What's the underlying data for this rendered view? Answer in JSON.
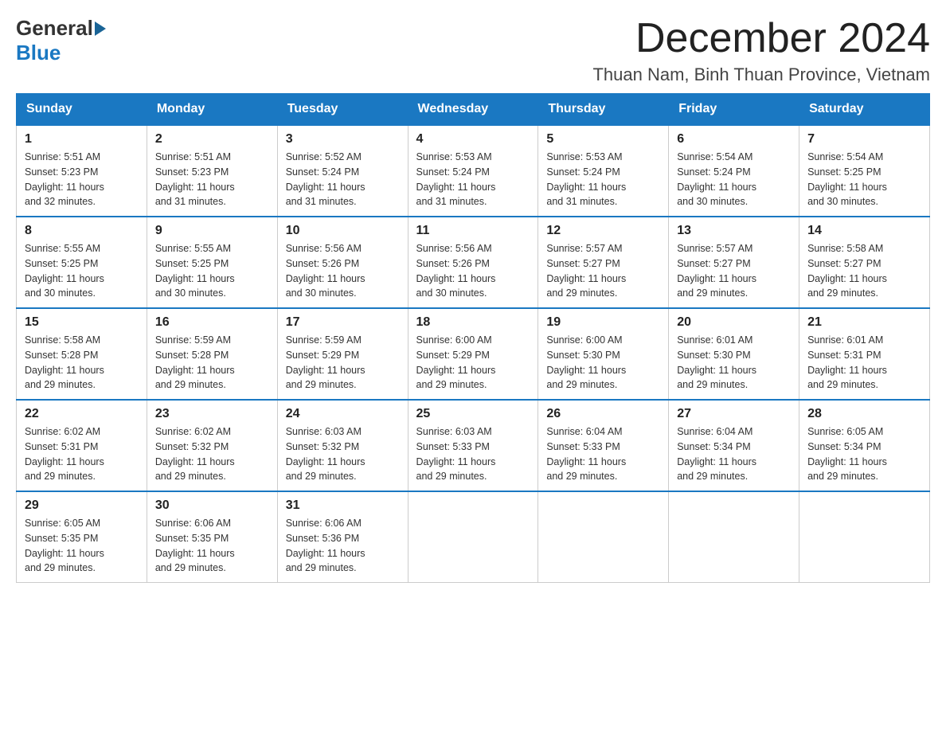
{
  "logo": {
    "general": "General",
    "blue": "Blue"
  },
  "title": "December 2024",
  "location": "Thuan Nam, Binh Thuan Province, Vietnam",
  "weekdays": [
    "Sunday",
    "Monday",
    "Tuesday",
    "Wednesday",
    "Thursday",
    "Friday",
    "Saturday"
  ],
  "weeks": [
    [
      {
        "day": "1",
        "sunrise": "5:51 AM",
        "sunset": "5:23 PM",
        "daylight": "11 hours and 32 minutes."
      },
      {
        "day": "2",
        "sunrise": "5:51 AM",
        "sunset": "5:23 PM",
        "daylight": "11 hours and 31 minutes."
      },
      {
        "day": "3",
        "sunrise": "5:52 AM",
        "sunset": "5:24 PM",
        "daylight": "11 hours and 31 minutes."
      },
      {
        "day": "4",
        "sunrise": "5:53 AM",
        "sunset": "5:24 PM",
        "daylight": "11 hours and 31 minutes."
      },
      {
        "day": "5",
        "sunrise": "5:53 AM",
        "sunset": "5:24 PM",
        "daylight": "11 hours and 31 minutes."
      },
      {
        "day": "6",
        "sunrise": "5:54 AM",
        "sunset": "5:24 PM",
        "daylight": "11 hours and 30 minutes."
      },
      {
        "day": "7",
        "sunrise": "5:54 AM",
        "sunset": "5:25 PM",
        "daylight": "11 hours and 30 minutes."
      }
    ],
    [
      {
        "day": "8",
        "sunrise": "5:55 AM",
        "sunset": "5:25 PM",
        "daylight": "11 hours and 30 minutes."
      },
      {
        "day": "9",
        "sunrise": "5:55 AM",
        "sunset": "5:25 PM",
        "daylight": "11 hours and 30 minutes."
      },
      {
        "day": "10",
        "sunrise": "5:56 AM",
        "sunset": "5:26 PM",
        "daylight": "11 hours and 30 minutes."
      },
      {
        "day": "11",
        "sunrise": "5:56 AM",
        "sunset": "5:26 PM",
        "daylight": "11 hours and 30 minutes."
      },
      {
        "day": "12",
        "sunrise": "5:57 AM",
        "sunset": "5:27 PM",
        "daylight": "11 hours and 29 minutes."
      },
      {
        "day": "13",
        "sunrise": "5:57 AM",
        "sunset": "5:27 PM",
        "daylight": "11 hours and 29 minutes."
      },
      {
        "day": "14",
        "sunrise": "5:58 AM",
        "sunset": "5:27 PM",
        "daylight": "11 hours and 29 minutes."
      }
    ],
    [
      {
        "day": "15",
        "sunrise": "5:58 AM",
        "sunset": "5:28 PM",
        "daylight": "11 hours and 29 minutes."
      },
      {
        "day": "16",
        "sunrise": "5:59 AM",
        "sunset": "5:28 PM",
        "daylight": "11 hours and 29 minutes."
      },
      {
        "day": "17",
        "sunrise": "5:59 AM",
        "sunset": "5:29 PM",
        "daylight": "11 hours and 29 minutes."
      },
      {
        "day": "18",
        "sunrise": "6:00 AM",
        "sunset": "5:29 PM",
        "daylight": "11 hours and 29 minutes."
      },
      {
        "day": "19",
        "sunrise": "6:00 AM",
        "sunset": "5:30 PM",
        "daylight": "11 hours and 29 minutes."
      },
      {
        "day": "20",
        "sunrise": "6:01 AM",
        "sunset": "5:30 PM",
        "daylight": "11 hours and 29 minutes."
      },
      {
        "day": "21",
        "sunrise": "6:01 AM",
        "sunset": "5:31 PM",
        "daylight": "11 hours and 29 minutes."
      }
    ],
    [
      {
        "day": "22",
        "sunrise": "6:02 AM",
        "sunset": "5:31 PM",
        "daylight": "11 hours and 29 minutes."
      },
      {
        "day": "23",
        "sunrise": "6:02 AM",
        "sunset": "5:32 PM",
        "daylight": "11 hours and 29 minutes."
      },
      {
        "day": "24",
        "sunrise": "6:03 AM",
        "sunset": "5:32 PM",
        "daylight": "11 hours and 29 minutes."
      },
      {
        "day": "25",
        "sunrise": "6:03 AM",
        "sunset": "5:33 PM",
        "daylight": "11 hours and 29 minutes."
      },
      {
        "day": "26",
        "sunrise": "6:04 AM",
        "sunset": "5:33 PM",
        "daylight": "11 hours and 29 minutes."
      },
      {
        "day": "27",
        "sunrise": "6:04 AM",
        "sunset": "5:34 PM",
        "daylight": "11 hours and 29 minutes."
      },
      {
        "day": "28",
        "sunrise": "6:05 AM",
        "sunset": "5:34 PM",
        "daylight": "11 hours and 29 minutes."
      }
    ],
    [
      {
        "day": "29",
        "sunrise": "6:05 AM",
        "sunset": "5:35 PM",
        "daylight": "11 hours and 29 minutes."
      },
      {
        "day": "30",
        "sunrise": "6:06 AM",
        "sunset": "5:35 PM",
        "daylight": "11 hours and 29 minutes."
      },
      {
        "day": "31",
        "sunrise": "6:06 AM",
        "sunset": "5:36 PM",
        "daylight": "11 hours and 29 minutes."
      },
      null,
      null,
      null,
      null
    ]
  ],
  "labels": {
    "sunrise": "Sunrise:",
    "sunset": "Sunset:",
    "daylight": "Daylight:"
  }
}
